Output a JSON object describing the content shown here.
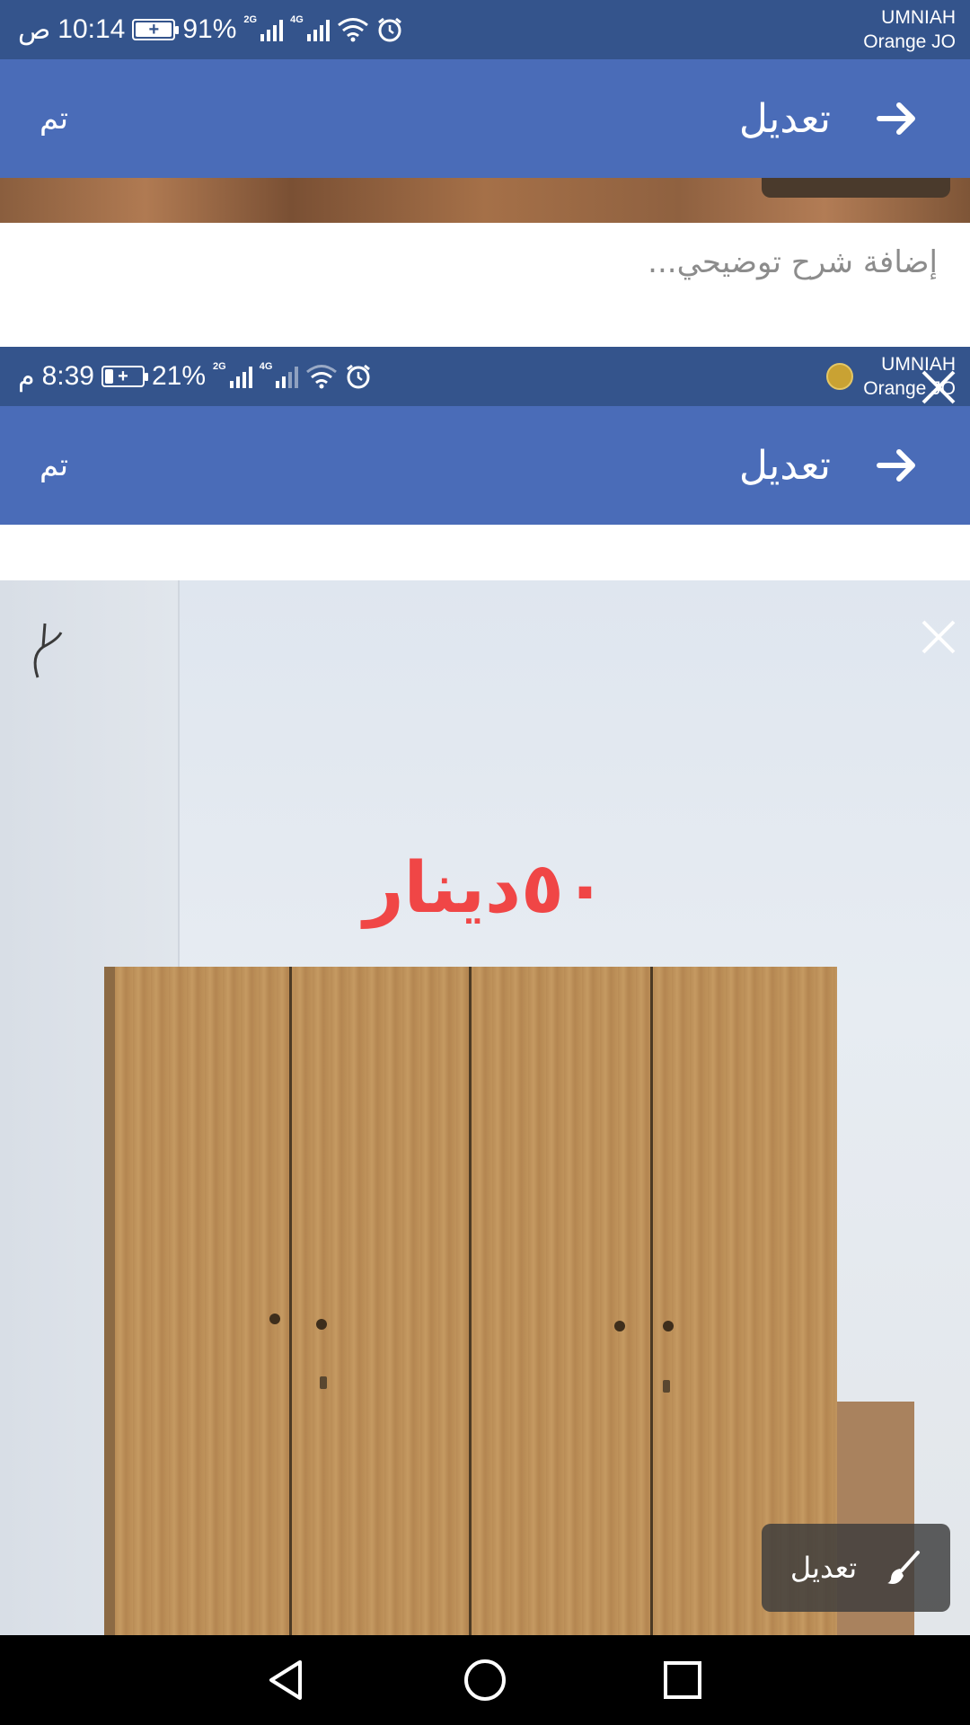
{
  "status_bar_top": {
    "time": "10:14",
    "am_pm": "ص",
    "battery_percent": "91%",
    "network_2g": "2G",
    "network_4g": "4G",
    "carrier_1": "UMNIAH",
    "carrier_2": "Orange JO"
  },
  "toolbar_top": {
    "title": "تعديل",
    "done_label": "تم"
  },
  "caption": {
    "placeholder": "إضافة شرح توضيحي..."
  },
  "status_bar_second": {
    "time": "8:39",
    "am_pm": "م",
    "battery_percent": "21%",
    "network_2g": "2G",
    "network_4g": "4G",
    "carrier_1": "UMNIAH",
    "carrier_2": "Orange JO"
  },
  "toolbar_second": {
    "title": "تعديل",
    "done_label": "تم"
  },
  "photo": {
    "price_text": "٥٠دينار",
    "edit_label": "تعديل"
  },
  "icons": {
    "back": "arrow-right-icon",
    "close": "close-icon",
    "brush": "brush-icon",
    "nav_back": "triangle-back-icon",
    "nav_home": "circle-home-icon",
    "nav_recents": "square-recents-icon"
  },
  "colors": {
    "status_bar": "#34548c",
    "toolbar": "#4a6cb8",
    "price": "#f04646",
    "nav_bar": "#000000"
  }
}
